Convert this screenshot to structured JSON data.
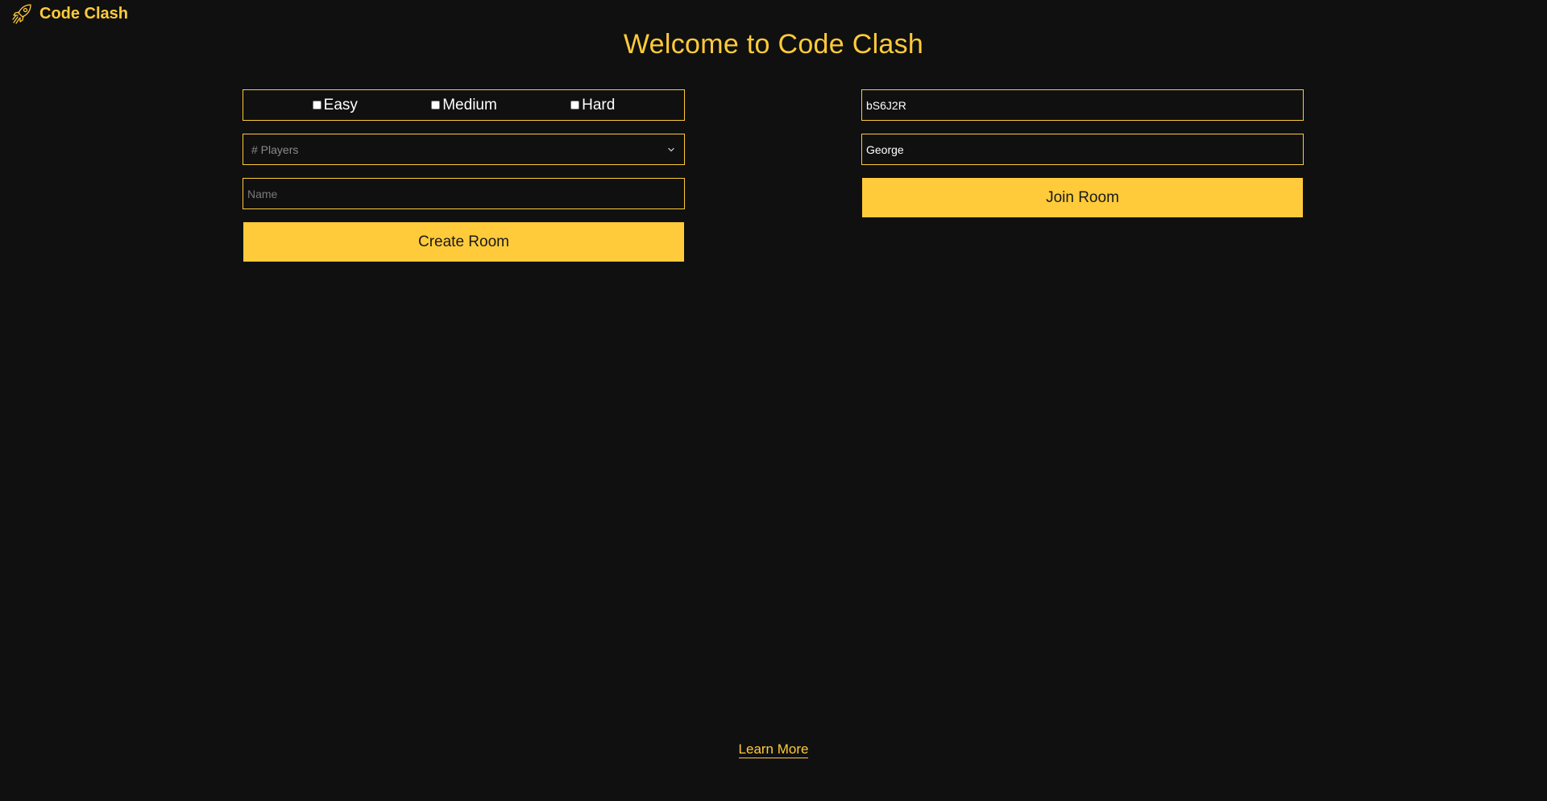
{
  "header": {
    "brand_name": "Code Clash",
    "brand_icon": "rocket-icon"
  },
  "main": {
    "title": "Welcome to Code Clash"
  },
  "create_room": {
    "difficulties": [
      {
        "label": "Easy",
        "checked": false
      },
      {
        "label": "Medium",
        "checked": false
      },
      {
        "label": "Hard",
        "checked": false
      }
    ],
    "players_select": {
      "placeholder": "# Players",
      "selected": ""
    },
    "name_input": {
      "placeholder": "Name",
      "value": ""
    },
    "button_label": "Create Room"
  },
  "join_room": {
    "room_code_input": {
      "value": "bS6J2R"
    },
    "name_input": {
      "value": "George"
    },
    "button_label": "Join Room"
  },
  "footer": {
    "learn_more_label": "Learn More"
  },
  "colors": {
    "background": "#101010",
    "accent": "#ffcb3a",
    "text_light": "#ffffff",
    "placeholder": "#7a7a7a"
  }
}
